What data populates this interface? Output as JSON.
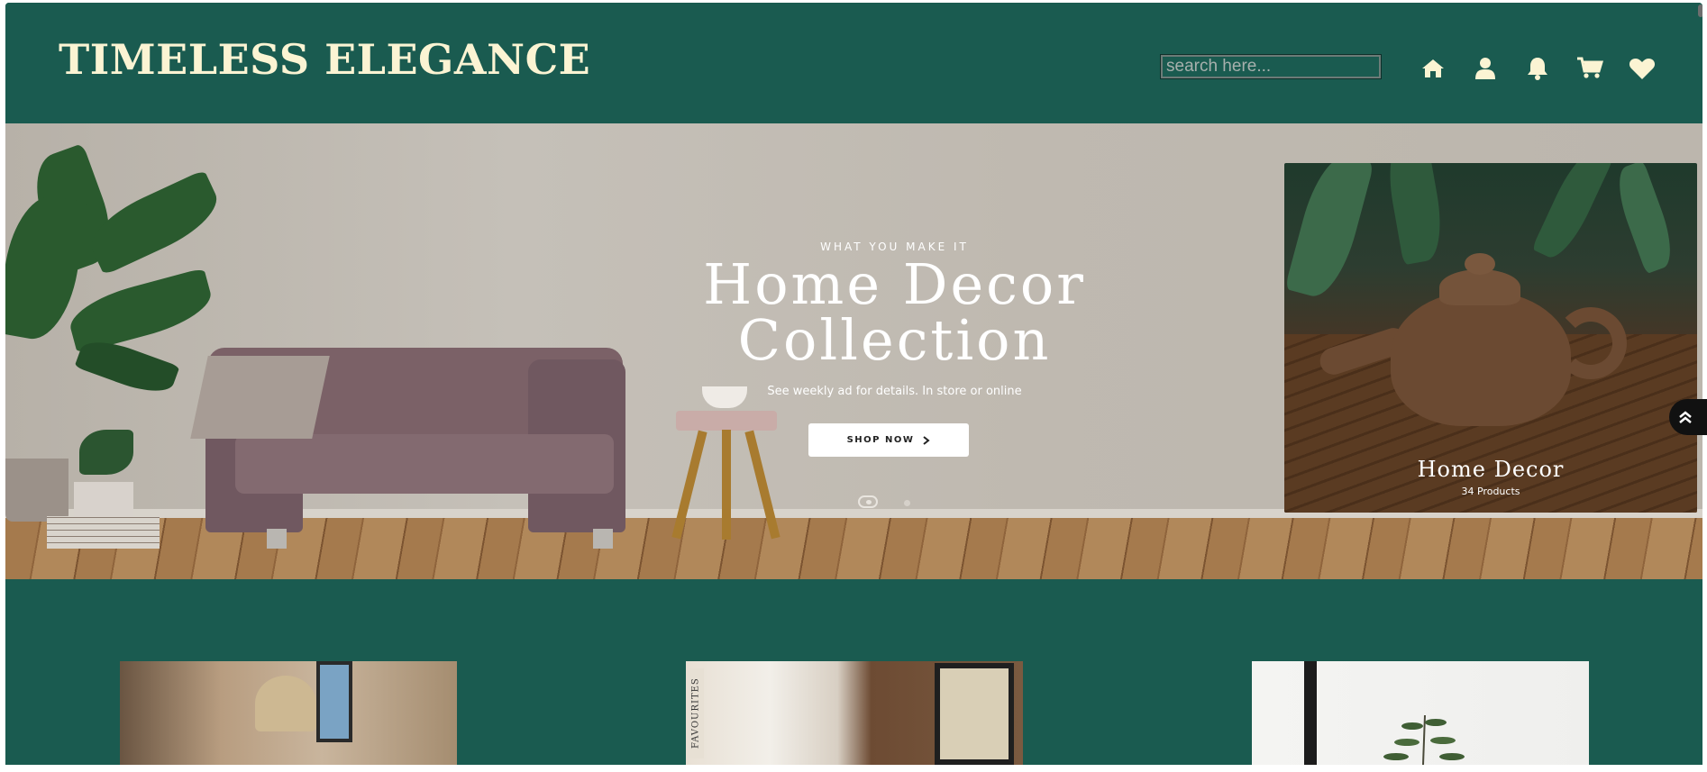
{
  "header": {
    "brand": "TIMELESS ELEGANCE",
    "search_placeholder": "search here...",
    "icons": [
      "home-icon",
      "user-icon",
      "bell-icon",
      "cart-icon",
      "heart-icon"
    ]
  },
  "hero": {
    "kicker": "WHAT YOU MAKE IT",
    "title_line1": "Home Decor",
    "title_line2": "Collection",
    "subtitle": "See weekly ad for details. In store or online",
    "cta_label": "SHOP NOW",
    "slides_total": 2,
    "active_slide": 1
  },
  "feature_card": {
    "title": "Home Decor",
    "count": "34 Products"
  },
  "tiles": {
    "fav_label": "FAVOURITES"
  },
  "colors": {
    "brand_green": "#1a5b50",
    "cream": "#fbf4d3"
  }
}
